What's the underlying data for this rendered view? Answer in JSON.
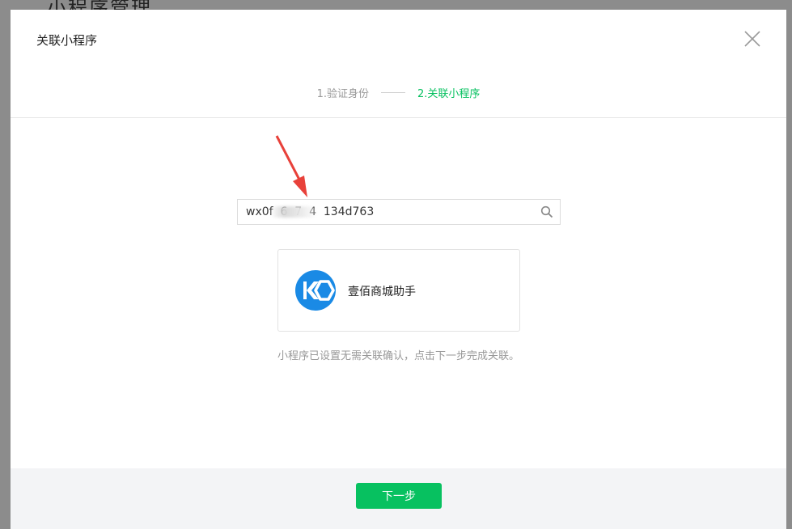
{
  "background": {
    "page_title": "小程序管理"
  },
  "dialog": {
    "title": "关联小程序",
    "steps": [
      {
        "label": "1.验证身份",
        "active": false
      },
      {
        "label": "2.关联小程序",
        "active": true
      }
    ],
    "search": {
      "value": "wx0f  6  7  4  134d763",
      "icon": "search-icon"
    },
    "result": {
      "app_name": "壹佰商城助手",
      "avatar_icon": "ko-logo-icon",
      "avatar_color": "#1a8ae5"
    },
    "hint": "小程序已设置无需关联确认，点击下一步完成关联。",
    "footer": {
      "next_label": "下一步"
    },
    "colors": {
      "accent": "#07c160",
      "annotation_arrow": "#e8413a"
    }
  }
}
